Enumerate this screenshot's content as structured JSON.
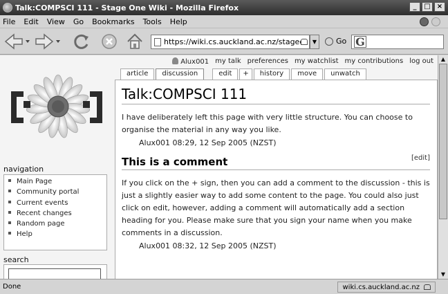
{
  "window": {
    "title": "Talk:COMPSCI 111 - Stage One Wiki - Mozilla Firefox",
    "controls": [
      "_",
      "□",
      "×"
    ]
  },
  "menubar": {
    "items": [
      "File",
      "Edit",
      "View",
      "Go",
      "Bookmarks",
      "Tools",
      "Help"
    ]
  },
  "toolbar": {
    "url": "https://wiki.cs.auckland.ac.nz/stageonewi",
    "go_label": "Go",
    "search_icon": "G",
    "icons": [
      "back-icon",
      "forward-icon",
      "reload-icon",
      "stop-icon",
      "home-icon"
    ]
  },
  "personal": {
    "user": "Alux001",
    "links": [
      "my talk",
      "preferences",
      "my watchlist",
      "my contributions",
      "log out"
    ]
  },
  "tabs": [
    {
      "label": "article"
    },
    {
      "label": "discussion",
      "active": true
    },
    {
      "label": "edit"
    },
    {
      "label": "+"
    },
    {
      "label": "history"
    },
    {
      "label": "move"
    },
    {
      "label": "unwatch"
    }
  ],
  "sidebar": {
    "navigation_title": "navigation",
    "navigation": [
      "Main Page",
      "Community portal",
      "Current events",
      "Recent changes",
      "Random page",
      "Help"
    ],
    "search_title": "search"
  },
  "content": {
    "title": "Talk:COMPSCI 111",
    "intro": "I have deliberately left this page with very little structure. You can choose to organise the material in any way you like.",
    "intro_sig": "Alux001 08:29, 12 Sep 2005 (NZST)",
    "section_title": "This is a comment",
    "section_edit": "[edit]",
    "section_text": "If you click on the + sign, then you can add a comment to the discussion - this is just a slightly easier way to add some content to the page. You could also just click on edit, however, adding a comment will automatically add a section heading for you. Please make sure that you sign your name when you make comments in a discussion.",
    "section_sig": "Alux001 08:32, 12 Sep 2005 (NZST)"
  },
  "status": {
    "text": "Done",
    "domain": "wiki.cs.auckland.ac.nz"
  }
}
